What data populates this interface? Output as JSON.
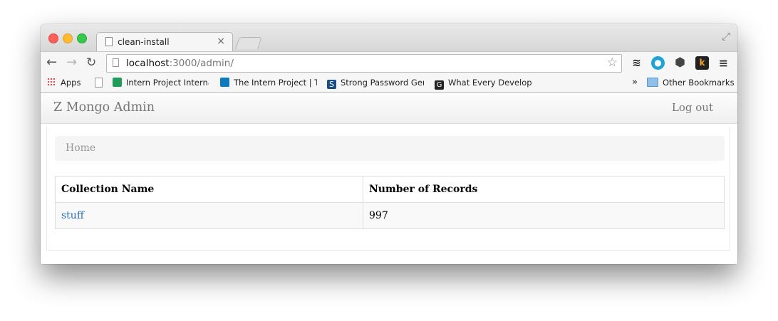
{
  "tab": {
    "title": "clean-install",
    "close": "×"
  },
  "address": {
    "host": "localhost",
    "rest": ":3000/admin/"
  },
  "bookmarks": {
    "apps": "Apps",
    "item1": "Intern Project Interna",
    "item2": "The Intern Project | T",
    "item3": "Strong Password Ger",
    "item3_icon": "S",
    "item4": "What Every Develope",
    "item4_icon": "G",
    "more": "»",
    "other": "Other Bookmarks"
  },
  "navbar": {
    "brand": "Z Mongo Admin",
    "logout": "Log out"
  },
  "breadcrumb": {
    "home": "Home"
  },
  "table": {
    "headers": [
      "Collection Name",
      "Number of Records"
    ],
    "rows": [
      {
        "name": "stuff",
        "count": "997"
      }
    ]
  },
  "icons": {
    "back": "back-arrow-icon",
    "forward": "forward-arrow-icon",
    "reload": "reload-icon",
    "star": "star-icon",
    "k": "k"
  },
  "colors": {
    "link": "#2a6fb5",
    "brand_text": "#777777",
    "breadcrumb_bg": "#f5f5f5"
  }
}
